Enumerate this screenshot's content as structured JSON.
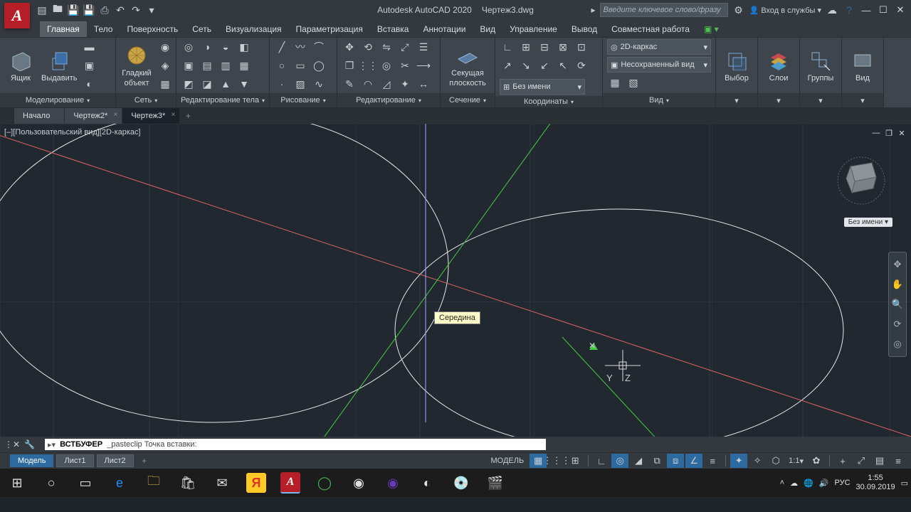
{
  "title": {
    "app": "Autodesk AutoCAD 2020",
    "doc": "Чертеж3.dwg"
  },
  "search": {
    "placeholder": "Введите ключевое слово/фразу"
  },
  "signin": "Вход в службы",
  "menu": [
    "Главная",
    "Тело",
    "Поверхность",
    "Сеть",
    "Визуализация",
    "Параметризация",
    "Вставка",
    "Аннотации",
    "Вид",
    "Управление",
    "Вывод",
    "Совместная работа"
  ],
  "panels": {
    "modeling": {
      "title": "Моделирование",
      "box": "Ящик",
      "extrude": "Выдавить",
      "smooth1": "Гладкий",
      "smooth2": "объект"
    },
    "net": {
      "title": "Сеть"
    },
    "solid_edit": {
      "title": "Редактирование тела"
    },
    "draw": {
      "title": "Рисование"
    },
    "edit": {
      "title": "Редактирование"
    },
    "section": {
      "title": "Сечение",
      "plane1": "Секущая",
      "plane2": "плоскость"
    },
    "coords": {
      "title": "Координаты",
      "noname": "Без имени"
    },
    "view": {
      "title": "Вид",
      "style": "2D-каркас",
      "saved": "Несохраненный вид"
    },
    "select": {
      "title": "Выбор",
      "label": "Выбор"
    },
    "layers": {
      "title": "Слои",
      "label": "Слои"
    },
    "groups": {
      "title": "Группы",
      "label": "Группы"
    },
    "viewpanel": {
      "title": "Вид",
      "label": "Вид"
    }
  },
  "tabs": [
    "Начало",
    "Чертеж2*",
    "Чертеж3*"
  ],
  "viewport": {
    "controls": "[–][Пользовательский вид][2D-каркас]",
    "tooltip": "Середина",
    "viewcube": "Без имени"
  },
  "axes": {
    "x": "X",
    "y": "Y",
    "z": "Z"
  },
  "command": {
    "label": "ВСТБУФЕР",
    "text": "_pasteclip Точка вставки:"
  },
  "layout": [
    "Модель",
    "Лист1",
    "Лист2"
  ],
  "status": {
    "model": "МОДЕЛЬ",
    "scale": "1:1"
  },
  "tray": {
    "lang": "РУС",
    "time": "1:55",
    "date": "30.09.2019"
  }
}
